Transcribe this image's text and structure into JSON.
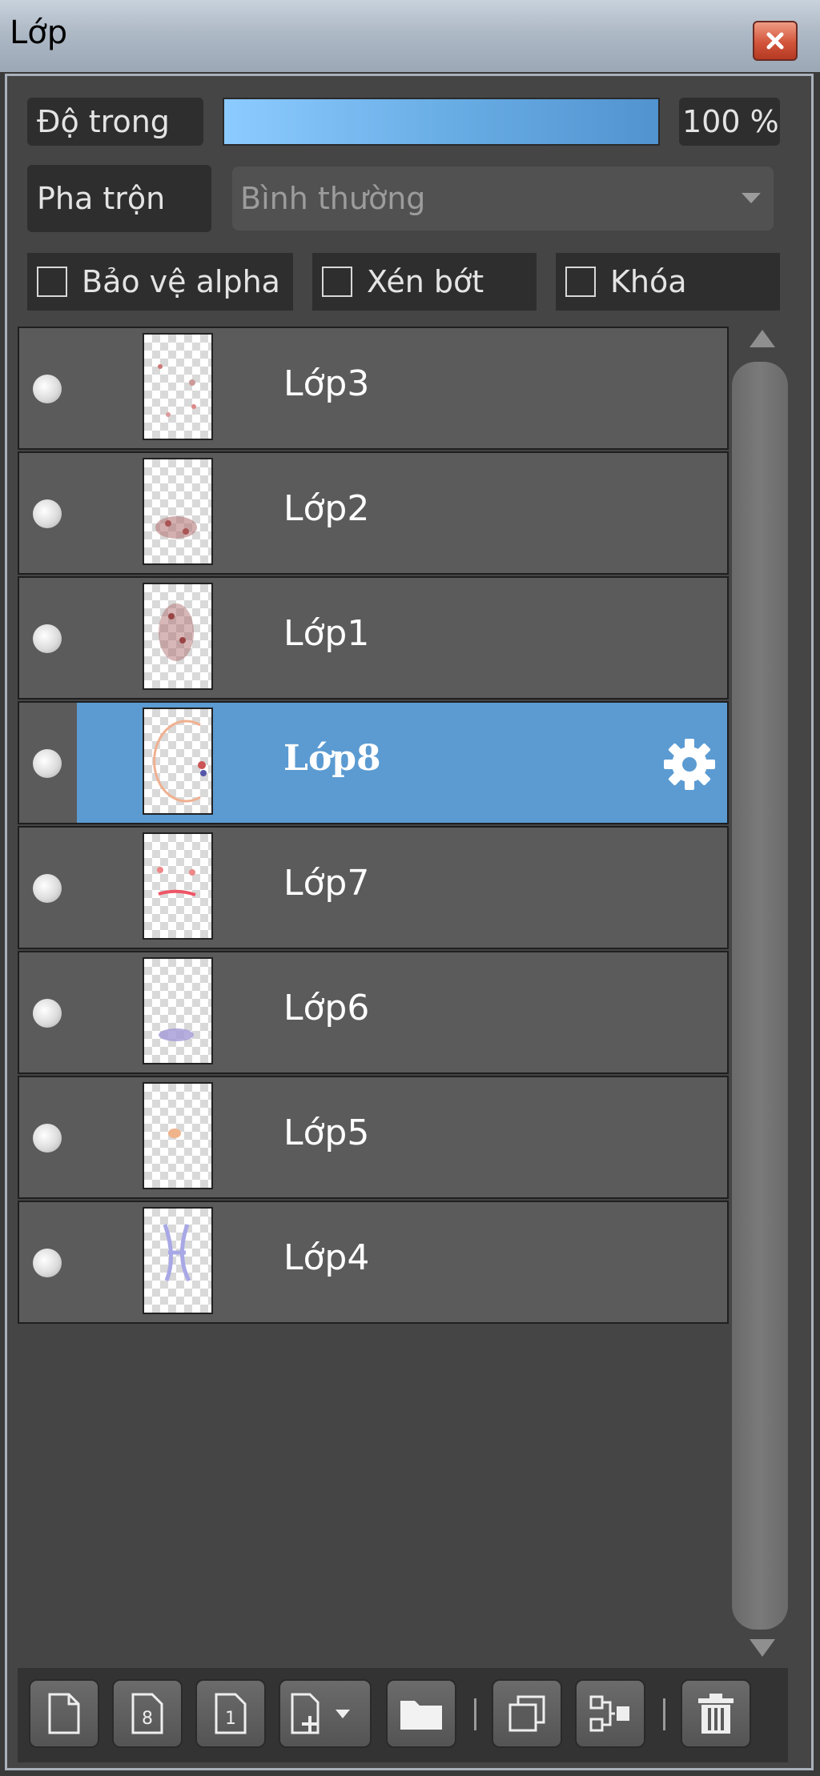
{
  "window": {
    "title": "Lớp",
    "close_label": "×"
  },
  "controls": {
    "opacity_label": "Độ trong",
    "opacity_value": "100 %",
    "opacity_fraction": 1.0,
    "blend_label": "Pha trộn",
    "blend_value": "Bình thường"
  },
  "checkboxes": [
    {
      "label": "Bảo vệ alpha",
      "checked": false
    },
    {
      "label": "Xén bớt",
      "checked": false
    },
    {
      "label": "Khóa",
      "checked": false
    }
  ],
  "layers": [
    {
      "name": "Lớp3",
      "selected": false
    },
    {
      "name": "Lớp2",
      "selected": false
    },
    {
      "name": "Lớp1",
      "selected": false
    },
    {
      "name": "Lớp8",
      "selected": true
    },
    {
      "name": "Lớp7",
      "selected": false
    },
    {
      "name": "Lớp6",
      "selected": false
    },
    {
      "name": "Lớp5",
      "selected": false
    },
    {
      "name": "Lớp4",
      "selected": false
    }
  ],
  "toolbar_icons": [
    "new-layer-icon",
    "new-8bit-layer-icon",
    "new-1bit-layer-icon",
    "add-layer-dropdown-icon",
    "folder-icon",
    "duplicate-layer-icon",
    "merge-layer-icon",
    "trash-icon"
  ],
  "colors": {
    "selection": "#5b9bd2",
    "opacity_fill": "#6aaee6",
    "close_button": "#d2553b"
  }
}
